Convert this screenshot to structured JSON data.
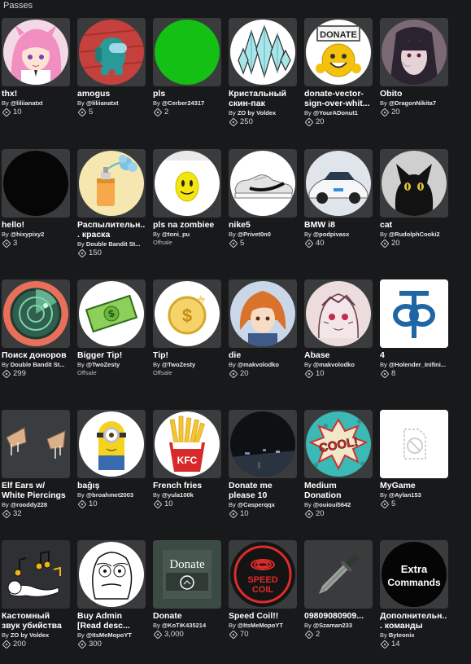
{
  "header": {
    "title": "Passes"
  },
  "by_prefix": "By",
  "offsale_label": "Offsale",
  "passes": [
    {
      "name": "thx!",
      "creator": "@liliianatxt",
      "price": "10",
      "icon": "anime-girl-pink-hair"
    },
    {
      "name": "amogus",
      "creator": "@liliianatxt",
      "price": "5",
      "icon": "among-us-crewmate"
    },
    {
      "name": "pls",
      "creator": "@Cerber24317",
      "price": "2",
      "icon": "green-square"
    },
    {
      "name": "Кристальный скин-пак",
      "creator": "ZO by Voldex",
      "price": "250",
      "icon": "crystals"
    },
    {
      "name": "donate-vector-sign-over-whit...",
      "creator": "@YourADonut1",
      "price": "20",
      "icon": "donate-smiley"
    },
    {
      "name": "Obito",
      "creator": "@DragonNikita7",
      "price": "20",
      "icon": "anime-character-obito"
    },
    {
      "name": "hello!",
      "creator": "@hixypixy2",
      "price": "3",
      "icon": "black-circle"
    },
    {
      "name": "Распылительн... краска",
      "creator": "Double Bandit St...",
      "price": "150",
      "icon": "spray-paint-can"
    },
    {
      "name": "pls na zombiee",
      "creator": "@toni_pu",
      "price": "",
      "offsale": true,
      "icon": "yellow-face"
    },
    {
      "name": "nike5",
      "creator": "@Privet0n0",
      "price": "5",
      "icon": "nike-sneaker"
    },
    {
      "name": "BMW i8",
      "creator": "@podpivasx",
      "price": "40",
      "icon": "bmw-car"
    },
    {
      "name": "cat",
      "creator": "@RudolphCooki2",
      "price": "20",
      "icon": "black-cat"
    },
    {
      "name": "Поиск доноров",
      "creator": "Double Bandit St...",
      "price": "299",
      "icon": "radar"
    },
    {
      "name": "Bigger Tip!",
      "creator": "@TwoZesty",
      "price": "",
      "offsale": true,
      "icon": "money-bill"
    },
    {
      "name": "Tip!",
      "creator": "@TwoZesty",
      "price": "",
      "offsale": true,
      "icon": "dollar-coin"
    },
    {
      "name": "die",
      "creator": "@makvolodko",
      "price": "20",
      "icon": "anime-boy-orange-hair"
    },
    {
      "name": "Abase",
      "creator": "@makvolodko",
      "price": "10",
      "icon": "anime-sketch"
    },
    {
      "name": "4",
      "creator": "@Holender_Inifini...",
      "price": "8",
      "icon": "blue-symbol"
    },
    {
      "name": "Elf Ears w/ White Piercings",
      "creator": "@rooddy228",
      "price": "32",
      "icon": "elf-ears"
    },
    {
      "name": "bağış",
      "creator": "@broahmet2003",
      "price": "10",
      "icon": "minion"
    },
    {
      "name": "French fries",
      "creator": "@yula100k",
      "price": "10",
      "icon": "kfc-fries"
    },
    {
      "name": "Donate me please 10",
      "creator": "@Casperqqx",
      "price": "10",
      "icon": "dark-scene"
    },
    {
      "name": "Medium Donation",
      "creator": "@ouioui5642",
      "price": "20",
      "icon": "cool-comic-burst"
    },
    {
      "name": "MyGame",
      "creator": "@Aylan153",
      "price": "5",
      "icon": "broken-image"
    },
    {
      "name": "Кастомный звук убийства",
      "creator": "ZO by Voldex",
      "price": "200",
      "icon": "music-notes-figure"
    },
    {
      "name": "Buy Admin [Read desc...",
      "creator": "@ItsMeMopoYT",
      "price": "300",
      "icon": "me-gusta-face"
    },
    {
      "name": "Donate",
      "creator": "@KoTiK435214",
      "price": "3,000",
      "icon": "donate-chalkboard"
    },
    {
      "name": "Speed Coil!!",
      "creator": "@ItsMeMopoYT",
      "price": "70",
      "icon": "speed-coil"
    },
    {
      "name": "09809080909...",
      "creator": "@Szaman233",
      "price": "2",
      "icon": "knife"
    },
    {
      "name": "Дополнительн... команды",
      "creator": "Byteonix",
      "price": "14",
      "icon": "extra-commands"
    }
  ],
  "icon_text": {
    "donate_sign": "DONATE",
    "donate_board": "Donate",
    "speed_coil": "SPEED COIL",
    "extra_commands": "Extra Commands",
    "cool": "COOL!",
    "kfc": "KFC",
    "bill": "$"
  }
}
